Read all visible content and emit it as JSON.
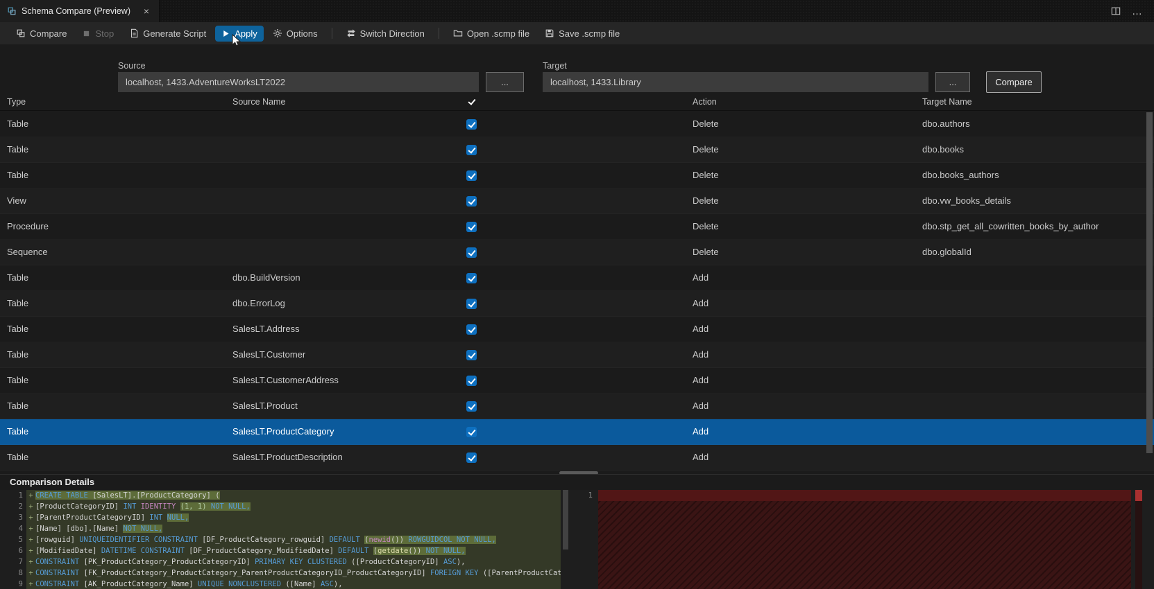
{
  "colors": {
    "accent": "#0e639c",
    "row_selection": "#0b5a9c",
    "checkbox_blue": "#0e70c0",
    "diff_add_line": "rgba(155,185,85,0.18)",
    "diff_add_word": "rgba(155,185,85,0.40)",
    "diff_remove_bg": "#3a1414"
  },
  "tabbar": {
    "title": "Schema Compare (Preview)",
    "close_glyph": "×",
    "more_glyph": "…"
  },
  "toolbar": {
    "items": [
      {
        "id": "compare",
        "label": "Compare",
        "icon": "compare-icon",
        "enabled": true
      },
      {
        "id": "stop",
        "label": "Stop",
        "icon": "stop-icon",
        "enabled": false
      },
      {
        "id": "generate-script",
        "label": "Generate Script",
        "icon": "script-icon",
        "enabled": true
      },
      {
        "id": "apply",
        "label": "Apply",
        "icon": "play-icon",
        "enabled": true,
        "highlighted": true
      },
      {
        "id": "options",
        "label": "Options",
        "icon": "gear-icon",
        "enabled": true
      },
      {
        "sep": true
      },
      {
        "id": "switch-direction",
        "label": "Switch Direction",
        "icon": "switch-icon",
        "enabled": true
      },
      {
        "sep": true
      },
      {
        "id": "open-scmp",
        "label": "Open .scmp file",
        "icon": "open-icon",
        "enabled": true
      },
      {
        "id": "save-scmp",
        "label": "Save .scmp file",
        "icon": "save-icon",
        "enabled": true
      }
    ]
  },
  "connections": {
    "source": {
      "label": "Source",
      "value": "localhost, 1433.AdventureWorksLT2022",
      "browse_label": "..."
    },
    "target": {
      "label": "Target",
      "value": "localhost, 1433.Library",
      "browse_label": "..."
    },
    "compare_button": "Compare"
  },
  "grid": {
    "headers": {
      "type": "Type",
      "source_name": "Source Name",
      "action": "Action",
      "target_name": "Target Name"
    },
    "header_checked": true,
    "rows": [
      {
        "type": "Table",
        "source": "",
        "checked": true,
        "action": "Delete",
        "target": "dbo.authors"
      },
      {
        "type": "Table",
        "source": "",
        "checked": true,
        "action": "Delete",
        "target": "dbo.books"
      },
      {
        "type": "Table",
        "source": "",
        "checked": true,
        "action": "Delete",
        "target": "dbo.books_authors"
      },
      {
        "type": "View",
        "source": "",
        "checked": true,
        "action": "Delete",
        "target": "dbo.vw_books_details"
      },
      {
        "type": "Procedure",
        "source": "",
        "checked": true,
        "action": "Delete",
        "target": "dbo.stp_get_all_cowritten_books_by_author"
      },
      {
        "type": "Sequence",
        "source": "",
        "checked": true,
        "action": "Delete",
        "target": "dbo.globalId"
      },
      {
        "type": "Table",
        "source": "dbo.BuildVersion",
        "checked": true,
        "action": "Add",
        "target": ""
      },
      {
        "type": "Table",
        "source": "dbo.ErrorLog",
        "checked": true,
        "action": "Add",
        "target": ""
      },
      {
        "type": "Table",
        "source": "SalesLT.Address",
        "checked": true,
        "action": "Add",
        "target": ""
      },
      {
        "type": "Table",
        "source": "SalesLT.Customer",
        "checked": true,
        "action": "Add",
        "target": ""
      },
      {
        "type": "Table",
        "source": "SalesLT.CustomerAddress",
        "checked": true,
        "action": "Add",
        "target": ""
      },
      {
        "type": "Table",
        "source": "SalesLT.Product",
        "checked": true,
        "action": "Add",
        "target": ""
      },
      {
        "type": "Table",
        "source": "SalesLT.ProductCategory",
        "checked": true,
        "action": "Add",
        "target": "",
        "selected": true
      },
      {
        "type": "Table",
        "source": "SalesLT.ProductDescription",
        "checked": true,
        "action": "Add",
        "target": ""
      }
    ]
  },
  "details": {
    "title": "Comparison Details",
    "right_gutter": "1",
    "left_lines": [
      {
        "num": "1",
        "marker": "+",
        "tokens": [
          [
            "k",
            "CREATE TABLE ",
            1
          ],
          [
            "d",
            "[SalesLT].[ProductCategory] (",
            1
          ]
        ]
      },
      {
        "num": "2",
        "marker": "+",
        "tokens": [
          [
            "d",
            "[ProductCategoryID] "
          ],
          [
            "k",
            "INT "
          ],
          [
            "m",
            "IDENTITY "
          ],
          [
            "n",
            "(1, 1)",
            1
          ],
          [
            "k",
            " NOT NULL,",
            1
          ]
        ]
      },
      {
        "num": "3",
        "marker": "+",
        "tokens": [
          [
            "d",
            "[ParentProductCategoryID] "
          ],
          [
            "k",
            "INT "
          ],
          [
            "k",
            "NULL,",
            1
          ]
        ]
      },
      {
        "num": "4",
        "marker": "+",
        "tokens": [
          [
            "d",
            "[Name] [dbo].[Name] "
          ],
          [
            "k",
            "NOT NULL,",
            1
          ]
        ]
      },
      {
        "num": "5",
        "marker": "+",
        "tokens": [
          [
            "d",
            "[rowguid] "
          ],
          [
            "k",
            "UNIQUEIDENTIFIER "
          ],
          [
            "k",
            "CONSTRAINT "
          ],
          [
            "d",
            "[DF_ProductCategory_rowguid] "
          ],
          [
            "k",
            "DEFAULT "
          ],
          [
            "d",
            "(",
            1
          ],
          [
            "m",
            "newid",
            1
          ],
          [
            "d",
            "())",
            1
          ],
          [
            "k",
            " ROWGUIDCOL NOT NULL,",
            1
          ]
        ]
      },
      {
        "num": "6",
        "marker": "+",
        "tokens": [
          [
            "d",
            "[ModifiedDate] "
          ],
          [
            "k",
            "DATETIME "
          ],
          [
            "k",
            "CONSTRAINT "
          ],
          [
            "d",
            "[DF_ProductCategory_ModifiedDate] "
          ],
          [
            "k",
            "DEFAULT "
          ],
          [
            "d",
            "(",
            1
          ],
          [
            "y",
            "getdate",
            1
          ],
          [
            "d",
            "())",
            1
          ],
          [
            "k",
            " NOT NULL,",
            1
          ]
        ]
      },
      {
        "num": "7",
        "marker": "+",
        "tokens": [
          [
            "k",
            "CONSTRAINT "
          ],
          [
            "d",
            "[PK_ProductCategory_ProductCategoryID] "
          ],
          [
            "k",
            "PRIMARY KEY CLUSTERED "
          ],
          [
            "d",
            "([ProductCategoryID] "
          ],
          [
            "k",
            "ASC"
          ],
          [
            "d",
            "),"
          ]
        ]
      },
      {
        "num": "8",
        "marker": "+",
        "tokens": [
          [
            "k",
            "CONSTRAINT "
          ],
          [
            "d",
            "[FK_ProductCategory_ProductCategory_ParentProductCategoryID_ProductCategoryID] "
          ],
          [
            "k",
            "FOREIGN KEY "
          ],
          [
            "d",
            "([ParentProductCategoryID])"
          ]
        ]
      },
      {
        "num": "9",
        "marker": "+",
        "tokens": [
          [
            "k",
            "CONSTRAINT "
          ],
          [
            "d",
            "[AK_ProductCategory_Name] "
          ],
          [
            "k",
            "UNIQUE NONCLUSTERED "
          ],
          [
            "d",
            "([Name] "
          ],
          [
            "k",
            "ASC"
          ],
          [
            "d",
            "),"
          ]
        ]
      }
    ]
  }
}
